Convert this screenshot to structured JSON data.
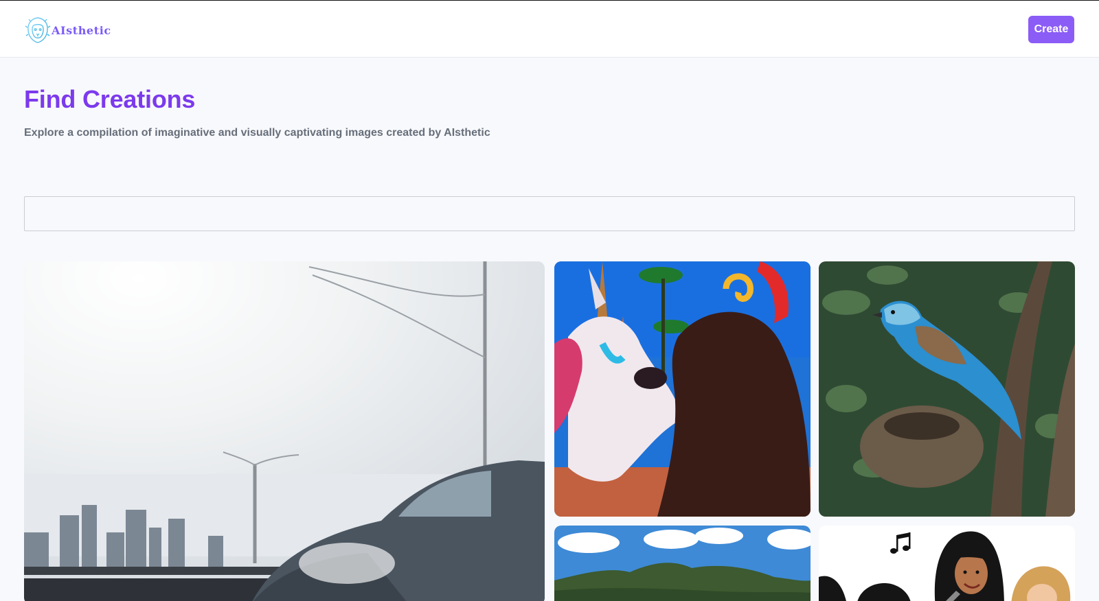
{
  "header": {
    "logo_text": "AIsthetic",
    "logo_icon": "lion-icon",
    "create_label": "Create"
  },
  "main": {
    "title": "Find Creations",
    "subtitle": "Explore a compilation of imaginative and visually captivating images created by AIsthetic",
    "search": {
      "value": "",
      "placeholder": ""
    }
  },
  "gallery": {
    "items": [
      {
        "subject": "car-on-bridge-city-skyline-image"
      },
      {
        "subject": "unicorn-and-girl-image"
      },
      {
        "subject": "blue-bird-on-nest-image"
      },
      {
        "subject": "mountain-landscape-image"
      },
      {
        "subject": "cartoon-singers-image"
      }
    ]
  },
  "colors": {
    "accent": "#7c3aed",
    "button": "#8b5cf6",
    "background": "#f8f9fc"
  }
}
